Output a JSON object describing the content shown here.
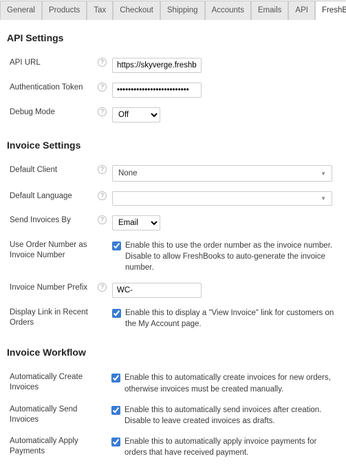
{
  "tabs": {
    "general": "General",
    "products": "Products",
    "tax": "Tax",
    "checkout": "Checkout",
    "shipping": "Shipping",
    "accounts": "Accounts",
    "emails": "Emails",
    "api": "API",
    "freshbooks": "FreshBooks"
  },
  "sections": {
    "api": "API Settings",
    "invoice": "Invoice Settings",
    "workflow": "Invoice Workflow"
  },
  "api": {
    "url_label": "API URL",
    "url_value": "https://skyverge.freshb",
    "token_label": "Authentication Token",
    "token_value": "••••••••••••••••••••••••••",
    "debug_label": "Debug Mode",
    "debug_value": "Off"
  },
  "invoice": {
    "client_label": "Default Client",
    "client_value": "None",
    "language_label": "Default Language",
    "language_value": "",
    "send_label": "Send Invoices By",
    "send_value": "Email",
    "order_number_label": "Use Order Number as Invoice Number",
    "order_number_desc": "Enable this to use the order number as the invoice number. Disable to allow FreshBooks to auto-generate the invoice number.",
    "prefix_label": "Invoice Number Prefix",
    "prefix_value": "WC-",
    "display_link_label": "Display Link in Recent Orders",
    "display_link_desc": "Enable this to display a \"View Invoice\" link for customers on the My Account page."
  },
  "workflow": {
    "auto_create_label": "Automatically Create Invoices",
    "auto_create_desc": "Enable this to automatically create invoices for new orders, otherwise invoices must be created manually.",
    "auto_send_label": "Automatically Send Invoices",
    "auto_send_desc": "Enable this to automatically send invoices after creation. Disable to leave created invoices as drafts.",
    "auto_apply_label": "Automatically Apply Payments",
    "auto_apply_desc": "Enable this to automatically apply invoice payments for orders that have received payment."
  }
}
